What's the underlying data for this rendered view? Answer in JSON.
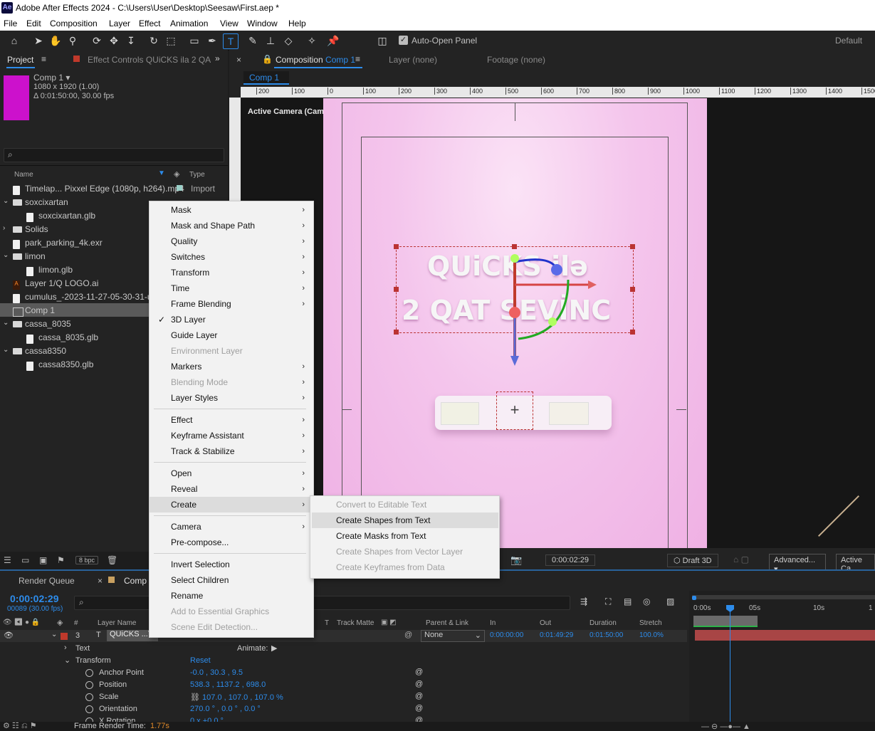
{
  "titlebar": {
    "title": "Adobe After Effects 2024 - C:\\Users\\User\\Desktop\\Seesaw\\First.aep *",
    "app_badge": "Ae"
  },
  "menubar": [
    "File",
    "Edit",
    "Composition",
    "Layer",
    "Effect",
    "Animation",
    "View",
    "Window",
    "Help"
  ],
  "toolbar": {
    "auto_open_panel": "Auto-Open Panel",
    "workspace": "Default"
  },
  "project": {
    "tab_label": "Project",
    "effect_controls_tab": "Effect Controls QUiCKS ila 2 QA",
    "comp_name": "Comp 1",
    "comp_info_line1": "1080 x 1920 (1.00)",
    "comp_info_line2": "Δ 0:01:50:00, 30.00 fps",
    "search_placeholder": "⌕",
    "col_name": "Name",
    "col_type": "Type",
    "items": [
      {
        "name": "Timelap... Pixxel Edge (1080p, h264).mp4",
        "type": "Import"
      },
      {
        "name": "soxcixartan",
        "type": ""
      },
      {
        "name": "soxcixartan.glb",
        "type": ""
      },
      {
        "name": "Solids",
        "type": ""
      },
      {
        "name": "park_parking_4k.exr",
        "type": ""
      },
      {
        "name": "limon",
        "type": ""
      },
      {
        "name": "limon.glb",
        "type": ""
      },
      {
        "name": "Layer 1/Q LOGO.ai",
        "type": ""
      },
      {
        "name": "cumulus_-2023-11-27-05-30-31-utc",
        "type": ""
      },
      {
        "name": "Comp 1",
        "type": ""
      },
      {
        "name": "cassa_8035",
        "type": ""
      },
      {
        "name": "cassa_8035.glb",
        "type": ""
      },
      {
        "name": "cassa8350",
        "type": ""
      },
      {
        "name": "cassa8350.glb",
        "type": ""
      }
    ],
    "bpc": "8 bpc"
  },
  "composition": {
    "tab_prefix": "Composition",
    "tab_name": "Comp 1",
    "layer_tab": "Layer (none)",
    "footage_tab": "Footage (none)",
    "breadcrumb": "Comp 1",
    "active_camera": "Active Camera (Camera 1)",
    "ruler": [
      "200",
      "100",
      "0",
      "100",
      "200",
      "300",
      "400",
      "500",
      "600",
      "700",
      "800",
      "900",
      "1000",
      "1100",
      "1200",
      "1300",
      "1400",
      "1500"
    ],
    "title_line1": "QUiCKS ilə",
    "title_line2": "2 QAT SEVİNC",
    "timecode": "0:00:02:29",
    "draft3d": "Draft 3D",
    "renderer": "Advanced...",
    "camera_view": "Active Ca"
  },
  "context_menu": {
    "items": [
      {
        "label": "Mask",
        "sub": true,
        "disabled": false,
        "check": false
      },
      {
        "label": "Mask and Shape Path",
        "sub": true,
        "disabled": false,
        "check": false
      },
      {
        "label": "Quality",
        "sub": true,
        "disabled": false,
        "check": false
      },
      {
        "label": "Switches",
        "sub": true,
        "disabled": false,
        "check": false
      },
      {
        "label": "Transform",
        "sub": true,
        "disabled": false,
        "check": false
      },
      {
        "label": "Time",
        "sub": true,
        "disabled": false,
        "check": false
      },
      {
        "label": "Frame Blending",
        "sub": true,
        "disabled": false,
        "check": false
      },
      {
        "label": "3D Layer",
        "sub": false,
        "disabled": false,
        "check": true
      },
      {
        "label": "Guide Layer",
        "sub": false,
        "disabled": false,
        "check": false
      },
      {
        "label": "Environment Layer",
        "sub": false,
        "disabled": true,
        "check": false
      },
      {
        "label": "Markers",
        "sub": true,
        "disabled": false,
        "check": false
      },
      {
        "label": "Blending Mode",
        "sub": true,
        "disabled": true,
        "check": false
      },
      {
        "label": "Layer Styles",
        "sub": true,
        "disabled": false,
        "check": false
      },
      {
        "label": "Effect",
        "sub": true,
        "disabled": false,
        "check": false
      },
      {
        "label": "Keyframe Assistant",
        "sub": true,
        "disabled": false,
        "check": false
      },
      {
        "label": "Track & Stabilize",
        "sub": true,
        "disabled": false,
        "check": false
      },
      {
        "label": "Open",
        "sub": true,
        "disabled": false,
        "check": false
      },
      {
        "label": "Reveal",
        "sub": true,
        "disabled": false,
        "check": false
      },
      {
        "label": "Create",
        "sub": true,
        "disabled": false,
        "check": false
      },
      {
        "label": "Camera",
        "sub": true,
        "disabled": false,
        "check": false
      },
      {
        "label": "Pre-compose...",
        "sub": false,
        "disabled": false,
        "check": false
      },
      {
        "label": "Invert Selection",
        "sub": false,
        "disabled": false,
        "check": false
      },
      {
        "label": "Select Children",
        "sub": false,
        "disabled": false,
        "check": false
      },
      {
        "label": "Rename",
        "sub": false,
        "disabled": false,
        "check": false
      },
      {
        "label": "Add to Essential Graphics",
        "sub": false,
        "disabled": true,
        "check": false
      },
      {
        "label": "Scene Edit Detection...",
        "sub": false,
        "disabled": true,
        "check": false
      }
    ]
  },
  "create_submenu": {
    "items": [
      {
        "label": "Convert to Editable Text",
        "disabled": true
      },
      {
        "label": "Create Shapes from Text",
        "disabled": false
      },
      {
        "label": "Create Masks from Text",
        "disabled": false
      },
      {
        "label": "Create Shapes from Vector Layer",
        "disabled": true
      },
      {
        "label": "Create Keyframes from Data",
        "disabled": true
      }
    ]
  },
  "timeline": {
    "render_queue_tab": "Render Queue",
    "comp_tab": "Comp 1",
    "current_time": "0:00:02:29",
    "frame_info": "00089 (30.00 fps)",
    "col_layer_name": "Layer Name",
    "col_track_matte": "Track Matte",
    "col_parent": "Parent & Link",
    "col_in": "In",
    "col_out": "Out",
    "col_duration": "Duration",
    "col_stretch": "Stretch",
    "layer_number": "3",
    "layer_name": "QUiCKS ...T SEVİNC",
    "parent_value": "None",
    "in": "0:00:00:00",
    "out": "0:01:49:29",
    "duration": "0:01:50:00",
    "stretch": "100.0%",
    "ruler_labels": [
      "0:00s",
      "05s",
      "10s",
      "1"
    ],
    "props": [
      {
        "label": "Text",
        "value": "",
        "animate": "Animate:"
      },
      {
        "label": "Transform",
        "value": "Reset"
      },
      {
        "label": "Anchor Point",
        "value": "-0.0 , 30.3 , 9.5"
      },
      {
        "label": "Position",
        "value": "538.3 , 1137.2 , 698.0"
      },
      {
        "label": "Scale",
        "value": "107.0 , 107.0 , 107.0 %"
      },
      {
        "label": "Orientation",
        "value": "270.0 ° , 0.0 ° , 0.0 °"
      },
      {
        "label": "X Rotation",
        "value": "0 x +0.0 °"
      }
    ],
    "frame_render_label": "Frame Render Time:",
    "frame_render_value": "1.77s"
  },
  "colors": {
    "accent": "#2d8ceb",
    "comp_swatch": "#cc11cc",
    "layer_label": "#c0392b"
  }
}
